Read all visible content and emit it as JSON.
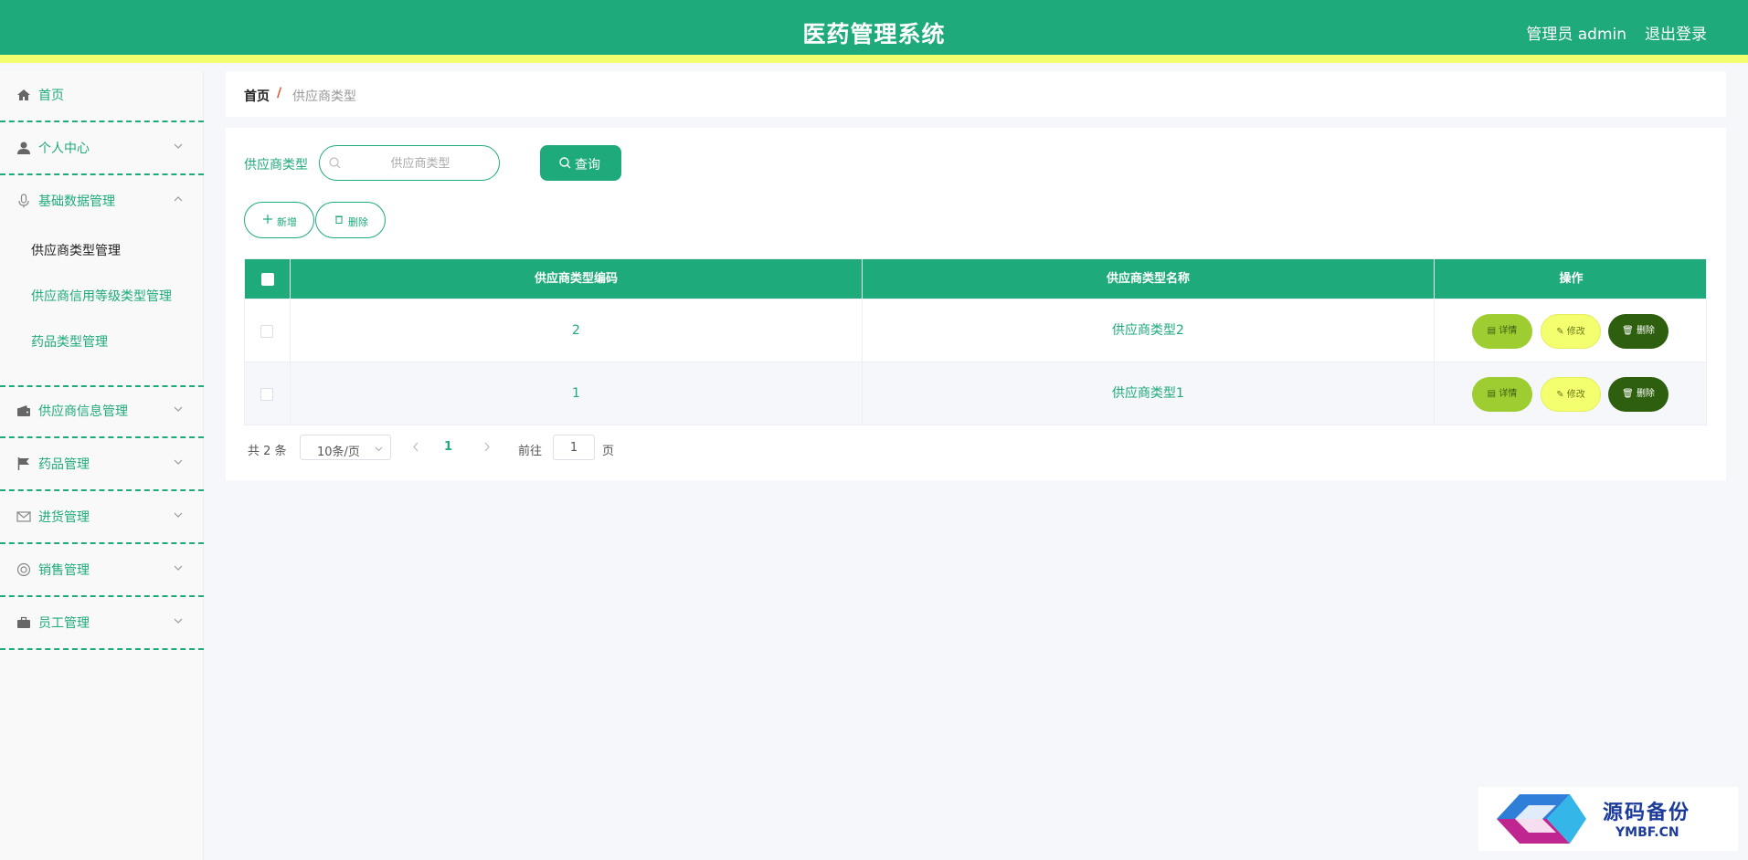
{
  "header": {
    "title": "医药管理系统",
    "user": "管理员 admin",
    "logout": "退出登录",
    "accent": "#1eaa7b",
    "stripe": "#f3ff6e"
  },
  "sidebar": {
    "home": "首页",
    "personal": "个人中心",
    "basic_data": "基础数据管理",
    "sub_items": [
      "供应商类型管理",
      "供应商信用等级类型管理",
      "药品类型管理"
    ],
    "supplier_info": "供应商信息管理",
    "drug": "药品管理",
    "purchase": "进货管理",
    "sales": "销售管理",
    "staff": "员工管理"
  },
  "breadcrumb": {
    "home": "首页",
    "separator": "/",
    "current": "供应商类型"
  },
  "search": {
    "label": "供应商类型",
    "placeholder": "供应商类型",
    "query_button": "查询"
  },
  "actions": {
    "add": "新增",
    "delete": "删除"
  },
  "table": {
    "headers": [
      "供应商类型编码",
      "供应商类型名称",
      "操作"
    ],
    "rows": [
      {
        "code": "2",
        "name": "供应商类型2"
      },
      {
        "code": "1",
        "name": "供应商类型1"
      }
    ],
    "op_detail": "详情",
    "op_edit": "修改",
    "op_delete": "删除"
  },
  "pagination": {
    "total": "共 2 条",
    "page_size": "10条/页",
    "current_page": "1",
    "goto_label": "前往",
    "goto_value": "1",
    "goto_unit": "页"
  },
  "watermark": {
    "brand": "源码备份",
    "domain": "YMBF.CN"
  }
}
